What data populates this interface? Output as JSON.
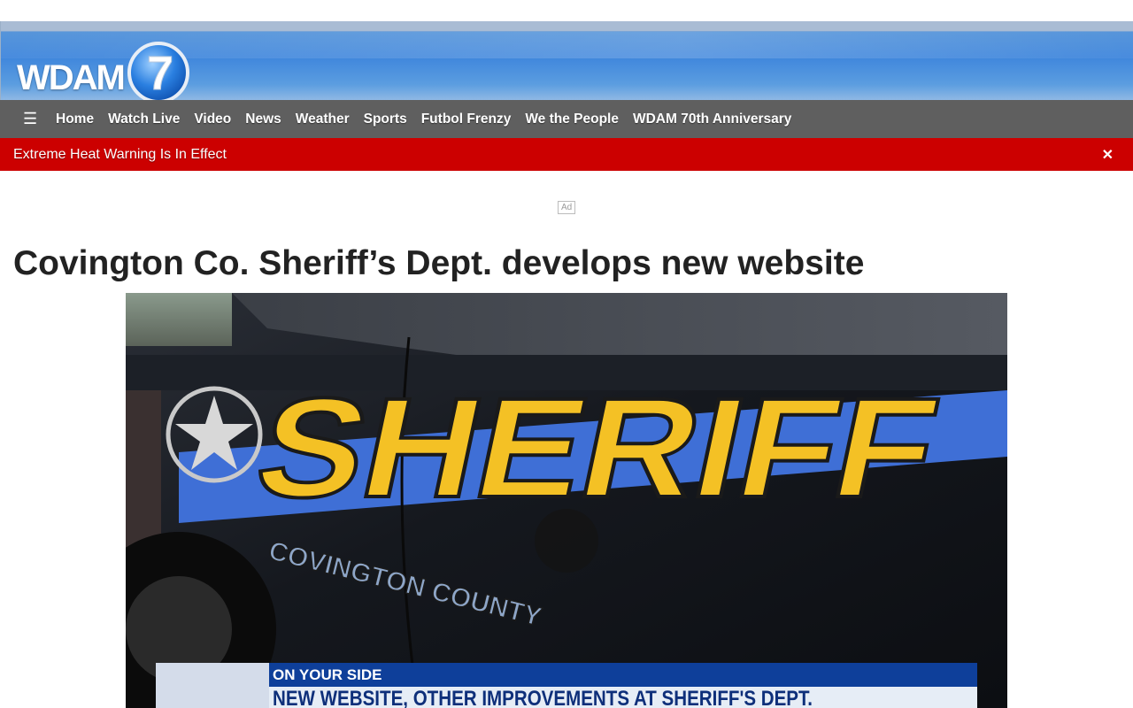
{
  "header": {
    "logo_text": "WDAM",
    "logo_number": "7"
  },
  "nav": {
    "menu_icon": "hamburger-icon",
    "items": [
      {
        "label": "Home"
      },
      {
        "label": "Watch Live"
      },
      {
        "label": "Video"
      },
      {
        "label": "News"
      },
      {
        "label": "Weather"
      },
      {
        "label": "Sports"
      },
      {
        "label": "Futbol Frenzy"
      },
      {
        "label": "We the People"
      },
      {
        "label": "WDAM 70th Anniversary"
      }
    ]
  },
  "alert": {
    "text": "Extreme Heat Warning Is In Effect",
    "close_icon": "close-icon",
    "color": "#cc0000"
  },
  "ad": {
    "label": "Ad"
  },
  "article": {
    "headline": "Covington Co. Sheriff’s Dept. develops new website"
  },
  "video": {
    "vehicle_text": "SHERIFF",
    "door_text": "COVINGTON COUNTY",
    "lower_third_tag": "ON YOUR SIDE",
    "lower_third_headline": "NEW WEBSITE, OTHER IMPROVEMENTS AT SHERIFF'S DEPT.",
    "play_icon": "play-icon"
  },
  "colors": {
    "brand_blue": "#3f86dc",
    "nav_gray": "#5f5f5f",
    "headline": "#222222"
  }
}
